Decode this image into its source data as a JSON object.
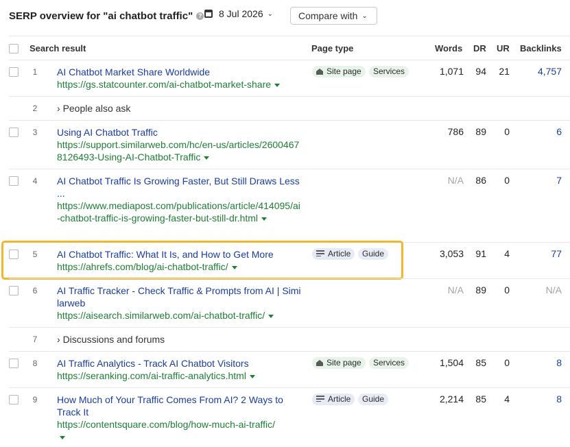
{
  "header": {
    "title": "SERP overview for \"ai chatbot traffic\"",
    "help_icon": "?",
    "date": "8 Jul 2026",
    "compare_label": "Compare with"
  },
  "columns": {
    "search_result": "Search result",
    "page_type": "Page type",
    "words": "Words",
    "dr": "DR",
    "ur": "UR",
    "backlinks": "Backlinks"
  },
  "rows": [
    {
      "pos": "1",
      "title": "AI Chatbot Market Share Worldwide",
      "url": "https://gs.statcounter.com/ai-chatbot-market-share",
      "tags": [
        "Site page",
        "Services"
      ],
      "words": "1,071",
      "dr": "94",
      "ur": "21",
      "backlinks": "4,757"
    },
    {
      "pos": "2",
      "label": "People also ask"
    },
    {
      "pos": "3",
      "title": "Using AI Chatbot Traffic",
      "url": "https://support.similarweb.com/hc/en-us/articles/26004678126493-Using-AI-Chatbot-Traffic",
      "words": "786",
      "dr": "89",
      "ur": "0",
      "backlinks": "6"
    },
    {
      "pos": "4",
      "title": "AI Chatbot Traffic Is Growing Faster, But Still Draws Less ...",
      "url": "https://www.mediapost.com/publications/article/414095/ai-chatbot-traffic-is-growing-faster-but-still-dr.html",
      "words": "N/A",
      "dr": "86",
      "ur": "0",
      "backlinks": "7"
    },
    {
      "pos": "5",
      "title": "AI Chatbot Traffic: What It Is, and How to Get More",
      "url": "https://ahrefs.com/blog/ai-chatbot-traffic/",
      "tags": [
        "Article",
        "Guide"
      ],
      "words": "3,053",
      "dr": "91",
      "ur": "4",
      "backlinks": "77"
    },
    {
      "pos": "6",
      "title": "AI Traffic Tracker - Check Traffic & Prompts from AI | Similarweb",
      "url": "https://aisearch.similarweb.com/ai-chatbot-traffic/",
      "words": "N/A",
      "dr": "89",
      "ur": "0",
      "backlinks": "N/A"
    },
    {
      "pos": "7",
      "label": "Discussions and forums"
    },
    {
      "pos": "8",
      "title": "AI Traffic Analytics - Track AI Chatbot Visitors",
      "url": "https://seranking.com/ai-traffic-analytics.html",
      "tags": [
        "Site page",
        "Services"
      ],
      "words": "1,504",
      "dr": "85",
      "ur": "0",
      "backlinks": "8"
    },
    {
      "pos": "9",
      "title": "How Much of Your Traffic Comes From AI? 2 Ways to Track It",
      "url": "https://contentsquare.com/blog/how-much-ai-traffic/",
      "tags": [
        "Article",
        "Guide"
      ],
      "words": "2,214",
      "dr": "85",
      "ur": "4",
      "backlinks": "8"
    }
  ],
  "colors": {
    "link": "#1b3e9e",
    "url": "#1e7e34",
    "highlight": "#f5b42a"
  }
}
